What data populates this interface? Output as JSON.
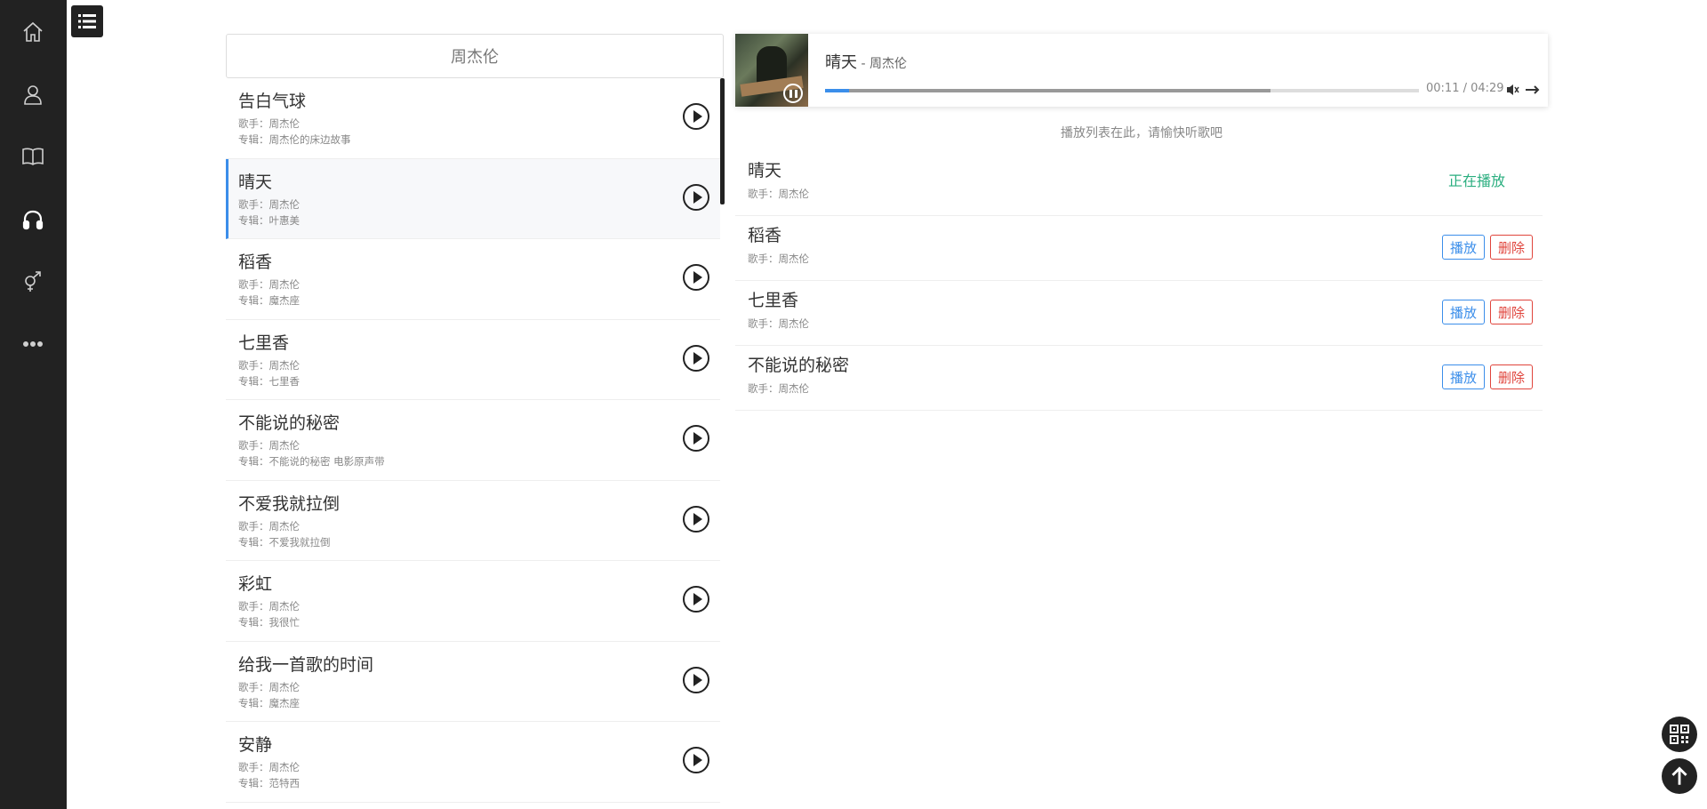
{
  "sidebar": {
    "items": [
      {
        "icon": "home-icon"
      },
      {
        "icon": "user-icon"
      },
      {
        "icon": "book-icon"
      },
      {
        "icon": "headphones-icon",
        "active": true
      },
      {
        "icon": "gender-icon"
      },
      {
        "icon": "more-icon"
      }
    ]
  },
  "search": {
    "value": "周杰伦"
  },
  "songs": [
    {
      "title": "告白气球",
      "artist": "歌手：周杰伦",
      "album": "专辑：周杰伦的床边故事"
    },
    {
      "title": "晴天",
      "artist": "歌手：周杰伦",
      "album": "专辑：叶惠美",
      "active": true
    },
    {
      "title": "稻香",
      "artist": "歌手：周杰伦",
      "album": "专辑：魔杰座"
    },
    {
      "title": "七里香",
      "artist": "歌手：周杰伦",
      "album": "专辑：七里香"
    },
    {
      "title": "不能说的秘密",
      "artist": "歌手：周杰伦",
      "album": "专辑：不能说的秘密 电影原声带"
    },
    {
      "title": "不爱我就拉倒",
      "artist": "歌手：周杰伦",
      "album": "专辑：不爱我就拉倒"
    },
    {
      "title": "彩虹",
      "artist": "歌手：周杰伦",
      "album": "专辑：我很忙"
    },
    {
      "title": "给我一首歌的时间",
      "artist": "歌手：周杰伦",
      "album": "专辑：魔杰座"
    },
    {
      "title": "安静",
      "artist": "歌手：周杰伦",
      "album": "专辑：范特西"
    }
  ],
  "player": {
    "title": "晴天",
    "separator": " - ",
    "artist": "周杰伦",
    "time": "00:11 / 04:29",
    "progress": 0.041,
    "buffered": 0.75
  },
  "playlist": {
    "hint": "播放列表在此，请愉快听歌吧",
    "play_label": "播放",
    "delete_label": "删除",
    "now_playing_label": "正在播放",
    "items": [
      {
        "title": "晴天",
        "artist": "歌手：周杰伦",
        "playing": true
      },
      {
        "title": "稻香",
        "artist": "歌手：周杰伦"
      },
      {
        "title": "七里香",
        "artist": "歌手：周杰伦"
      },
      {
        "title": "不能说的秘密",
        "artist": "歌手：周杰伦"
      }
    ]
  },
  "colors": {
    "accent": "#3b8eea",
    "danger": "#e0443c",
    "playing": "#2aae7f",
    "sidebar": "#222222"
  }
}
